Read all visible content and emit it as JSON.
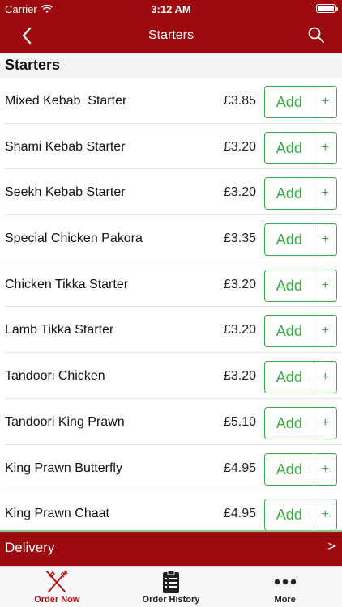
{
  "status_bar": {
    "carrier": "Carrier",
    "time": "3:12 AM"
  },
  "nav": {
    "title": "Starters"
  },
  "section": {
    "title": "Starters"
  },
  "items": [
    {
      "name": "Mixed Kebab  Starter",
      "price": "£3.85",
      "add": "Add",
      "plus": "+"
    },
    {
      "name": "Shami Kebab Starter",
      "price": "£3.20",
      "add": "Add",
      "plus": "+"
    },
    {
      "name": "Seekh Kebab Starter",
      "price": "£3.20",
      "add": "Add",
      "plus": "+"
    },
    {
      "name": "Special Chicken Pakora",
      "price": "£3.35",
      "add": "Add",
      "plus": "+"
    },
    {
      "name": "Chicken Tikka Starter",
      "price": "£3.20",
      "add": "Add",
      "plus": "+"
    },
    {
      "name": "Lamb Tikka Starter",
      "price": "£3.20",
      "add": "Add",
      "plus": "+"
    },
    {
      "name": "Tandoori Chicken",
      "price": "£3.20",
      "add": "Add",
      "plus": "+"
    },
    {
      "name": "Tandoori King Prawn",
      "price": "£5.10",
      "add": "Add",
      "plus": "+"
    },
    {
      "name": "King Prawn Butterfly",
      "price": "£4.95",
      "add": "Add",
      "plus": "+"
    },
    {
      "name": "King Prawn Chaat",
      "price": "£4.95",
      "add": "Add",
      "plus": "+"
    }
  ],
  "delivery": {
    "label": "Delivery",
    "chevron": ">"
  },
  "tabs": [
    {
      "label": "Order Now",
      "icon": "fork-knife-icon"
    },
    {
      "label": "Order History",
      "icon": "clipboard-icon"
    },
    {
      "label": "More",
      "icon": "more-dots-icon"
    }
  ],
  "colors": {
    "brand": "#9d0b0e",
    "accent_green": "#39a943",
    "active_tab": "#b3141a"
  }
}
